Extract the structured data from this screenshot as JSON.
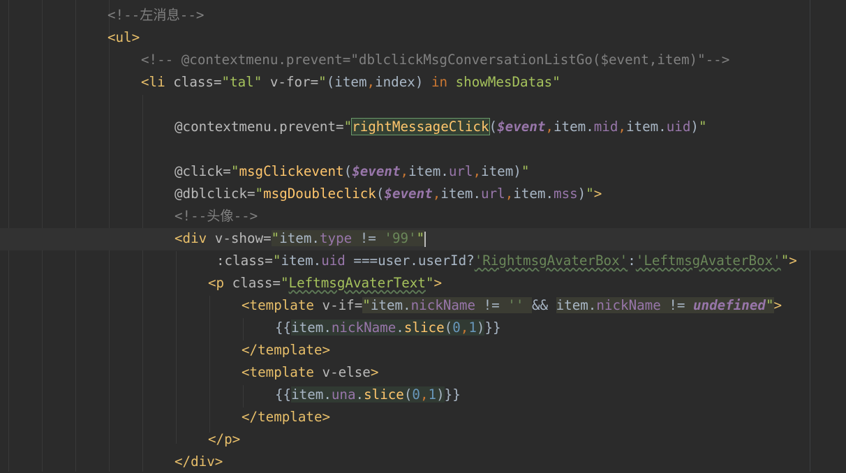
{
  "editor": {
    "lines": [
      {
        "id": "l0",
        "tokens": [
          {
            "t": "cmt",
            "v": "<!--左消息-->"
          }
        ]
      },
      {
        "id": "l1",
        "tokens": [
          {
            "t": "tag",
            "v": "<ul>"
          }
        ]
      },
      {
        "id": "l2",
        "tokens": [
          {
            "t": "cmt",
            "v": "<!-- @contextmenu.prevent=\"dblclickMsgConversationListGo($event,item)\"-->"
          }
        ]
      },
      {
        "id": "l3",
        "tokens": [
          {
            "t": "tag",
            "v": "<li "
          },
          {
            "t": "attr",
            "v": "class="
          },
          {
            "t": "str",
            "v": "\"tal\""
          },
          {
            "t": "attr",
            "v": " v-for="
          },
          {
            "t": "str",
            "v": "\""
          },
          {
            "t": "plain",
            "v": "(item"
          },
          {
            "t": "kw",
            "v": ","
          },
          {
            "t": "plain",
            "v": "index) "
          },
          {
            "t": "kw",
            "v": "in"
          },
          {
            "t": "plain",
            "v": " "
          },
          {
            "t": "str",
            "v": "showMesDatas\""
          }
        ]
      },
      {
        "id": "l4",
        "tokens": []
      },
      {
        "id": "l5",
        "tokens": [
          {
            "t": "attr",
            "v": "@contextmenu.prevent="
          },
          {
            "t": "str",
            "v": "\""
          },
          {
            "t": "fnbox",
            "v": "rightMessageClick"
          },
          {
            "t": "plain",
            "v": "("
          },
          {
            "t": "var",
            "v": "$event"
          },
          {
            "t": "kw",
            "v": ","
          },
          {
            "t": "plain",
            "v": "item."
          },
          {
            "t": "prop",
            "v": "mid"
          },
          {
            "t": "kw",
            "v": ","
          },
          {
            "t": "plain",
            "v": "item."
          },
          {
            "t": "prop",
            "v": "uid"
          },
          {
            "t": "plain",
            "v": ")"
          },
          {
            "t": "str",
            "v": "\""
          }
        ]
      },
      {
        "id": "l6",
        "tokens": []
      },
      {
        "id": "l7",
        "tokens": [
          {
            "t": "attr",
            "v": "@click="
          },
          {
            "t": "str",
            "v": "\""
          },
          {
            "t": "fn",
            "v": "msgClickevent"
          },
          {
            "t": "plain",
            "v": "("
          },
          {
            "t": "var",
            "v": "$event"
          },
          {
            "t": "kw",
            "v": ","
          },
          {
            "t": "plain",
            "v": "item."
          },
          {
            "t": "prop",
            "v": "url"
          },
          {
            "t": "kw",
            "v": ","
          },
          {
            "t": "plain",
            "v": "item)"
          },
          {
            "t": "str",
            "v": "\""
          }
        ]
      },
      {
        "id": "l8",
        "tokens": [
          {
            "t": "attr",
            "v": "@dblclick="
          },
          {
            "t": "str",
            "v": "\""
          },
          {
            "t": "fn",
            "v": "msgDoubleclick"
          },
          {
            "t": "plain",
            "v": "("
          },
          {
            "t": "var",
            "v": "$event"
          },
          {
            "t": "kw",
            "v": ","
          },
          {
            "t": "plain",
            "v": "item."
          },
          {
            "t": "prop",
            "v": "url"
          },
          {
            "t": "kw",
            "v": ","
          },
          {
            "t": "plain",
            "v": "item."
          },
          {
            "t": "prop",
            "v": "mss"
          },
          {
            "t": "plain",
            "v": ")"
          },
          {
            "t": "str",
            "v": "\""
          },
          {
            "t": "tag",
            "v": ">"
          }
        ]
      },
      {
        "id": "l9",
        "tokens": [
          {
            "t": "cmt",
            "v": "<!--头像-->"
          }
        ]
      },
      {
        "id": "l10",
        "tokens": [
          {
            "t": "tag",
            "v": "<div "
          },
          {
            "t": "attr",
            "v": "v-show="
          },
          {
            "t": "strhl",
            "v": "\""
          },
          {
            "t": "plainhl",
            "v": "item."
          },
          {
            "t": "prophl",
            "v": "type"
          },
          {
            "t": "plainhl",
            "v": " != "
          },
          {
            "t": "str2hl",
            "v": "'99'"
          },
          {
            "t": "strhl",
            "v": "\""
          },
          {
            "t": "caret",
            "v": ""
          }
        ]
      },
      {
        "id": "l11",
        "tokens": [
          {
            "t": "attr",
            "v": ":class="
          },
          {
            "t": "str",
            "v": "\""
          },
          {
            "t": "plain",
            "v": "item."
          },
          {
            "t": "prop",
            "v": "uid"
          },
          {
            "t": "plain",
            "v": " ===user.userId?"
          },
          {
            "t": "str2w",
            "v": "'RightmsgAvaterBox'"
          },
          {
            "t": "plain",
            "v": ":"
          },
          {
            "t": "str2w",
            "v": "'LeftmsgAvaterBox'"
          },
          {
            "t": "str",
            "v": "\""
          },
          {
            "t": "tag",
            "v": ">"
          }
        ]
      },
      {
        "id": "l12",
        "tokens": [
          {
            "t": "tag",
            "v": "<p "
          },
          {
            "t": "attr",
            "v": "class="
          },
          {
            "t": "str",
            "v": "\""
          },
          {
            "t": "strw",
            "v": "LeftmsgAvaterText"
          },
          {
            "t": "str",
            "v": "\""
          },
          {
            "t": "tag",
            "v": ">"
          }
        ]
      },
      {
        "id": "l13",
        "tokens": [
          {
            "t": "tag",
            "v": "<template "
          },
          {
            "t": "attr",
            "v": "v-if="
          },
          {
            "t": "strhl",
            "v": "\""
          },
          {
            "t": "plainhl",
            "v": "item."
          },
          {
            "t": "prophl",
            "v": "nickName"
          },
          {
            "t": "plainhl",
            "v": " != "
          },
          {
            "t": "str2hl",
            "v": "''"
          },
          {
            "t": "plainhl",
            "v": " "
          },
          {
            "t": "plain",
            "v": "&& "
          },
          {
            "t": "plainhl",
            "v": "item."
          },
          {
            "t": "prophl",
            "v": "nickName"
          },
          {
            "t": "plainhl",
            "v": " != "
          },
          {
            "t": "undefhl",
            "v": "undefined"
          },
          {
            "t": "strhl",
            "v": "\""
          },
          {
            "t": "tag",
            "v": ">"
          }
        ]
      },
      {
        "id": "l14",
        "tokens": [
          {
            "t": "plain",
            "v": "{{"
          },
          {
            "t": "plainex",
            "v": "item."
          },
          {
            "t": "propex",
            "v": "nickName"
          },
          {
            "t": "plainex",
            "v": "."
          },
          {
            "t": "fnex",
            "v": "slice"
          },
          {
            "t": "plainex",
            "v": "("
          },
          {
            "t": "numex",
            "v": "0"
          },
          {
            "t": "kwex",
            "v": ","
          },
          {
            "t": "numex",
            "v": "1"
          },
          {
            "t": "plainex",
            "v": ")"
          },
          {
            "t": "plain",
            "v": "}}"
          }
        ]
      },
      {
        "id": "l15",
        "tokens": [
          {
            "t": "tag",
            "v": "</template>"
          }
        ]
      },
      {
        "id": "l16",
        "tokens": [
          {
            "t": "tag",
            "v": "<template "
          },
          {
            "t": "attr",
            "v": "v-else"
          },
          {
            "t": "tag",
            "v": ">"
          }
        ]
      },
      {
        "id": "l17",
        "tokens": [
          {
            "t": "plain",
            "v": "{{"
          },
          {
            "t": "plainex",
            "v": "item."
          },
          {
            "t": "propex",
            "v": "una"
          },
          {
            "t": "plainex",
            "v": "."
          },
          {
            "t": "fnex",
            "v": "slice"
          },
          {
            "t": "plainex",
            "v": "("
          },
          {
            "t": "numex",
            "v": "0"
          },
          {
            "t": "kwex",
            "v": ","
          },
          {
            "t": "numex",
            "v": "1"
          },
          {
            "t": "plainex",
            "v": ")"
          },
          {
            "t": "plain",
            "v": "}}"
          }
        ]
      },
      {
        "id": "l18",
        "tokens": [
          {
            "t": "tag",
            "v": "</template>"
          }
        ]
      },
      {
        "id": "l19",
        "tokens": [
          {
            "t": "tag",
            "v": "</p>"
          }
        ]
      },
      {
        "id": "l20",
        "tokens": [
          {
            "t": "tag",
            "v": "</div>"
          }
        ]
      }
    ]
  }
}
